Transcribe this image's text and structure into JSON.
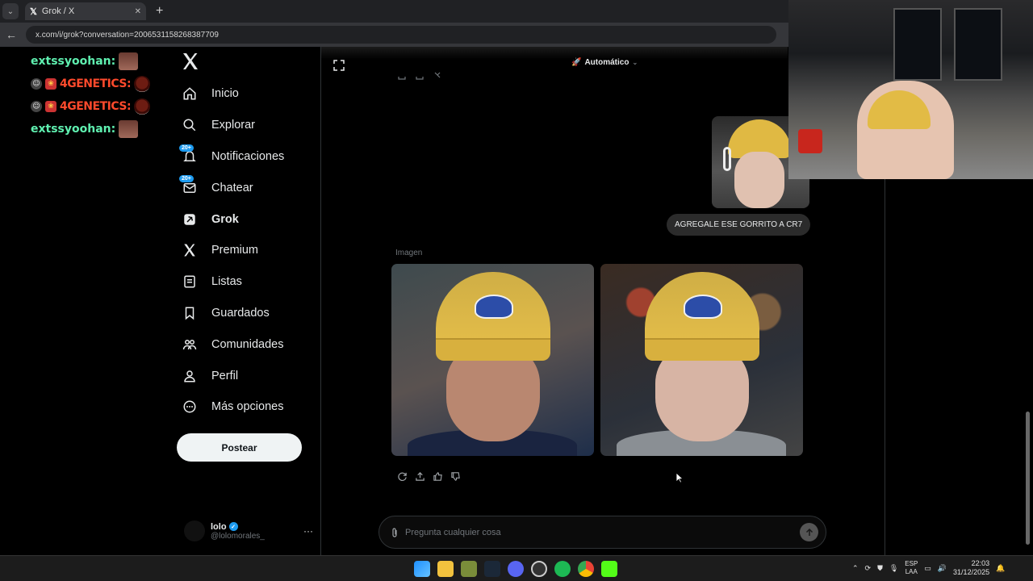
{
  "browser": {
    "tab_title": "Grok / X",
    "url": "x.com/i/grok?conversation=2006531158268387709",
    "new_tab": "+"
  },
  "stream_chat": {
    "lines": [
      {
        "user": "extssyoohan:"
      },
      {
        "user": "4GENETICS:"
      },
      {
        "user": "4GENETICS:"
      },
      {
        "user": "extssyoohan:"
      }
    ]
  },
  "sidebar": {
    "items": [
      {
        "label": "Inicio",
        "icon": "home-icon"
      },
      {
        "label": "Explorar",
        "icon": "search-icon"
      },
      {
        "label": "Notificaciones",
        "icon": "bell-icon",
        "badge": "20+"
      },
      {
        "label": "Chatear",
        "icon": "mail-icon",
        "badge": "20+"
      },
      {
        "label": "Grok",
        "icon": "grok-icon",
        "active": true
      },
      {
        "label": "Premium",
        "icon": "x-premium-icon"
      },
      {
        "label": "Listas",
        "icon": "list-icon"
      },
      {
        "label": "Guardados",
        "icon": "bookmark-icon"
      },
      {
        "label": "Comunidades",
        "icon": "communities-icon"
      },
      {
        "label": "Perfil",
        "icon": "person-icon"
      },
      {
        "label": "Más opciones",
        "icon": "more-circle-icon"
      }
    ],
    "post_button": "Postear",
    "profile": {
      "name": "lolo",
      "handle": "@lolomorales_",
      "more": "···"
    }
  },
  "grok": {
    "mode": "Automático",
    "user_message": "AGREGALE ESE GORRITO A CR7",
    "image_label": "Imagen",
    "composer_placeholder": "Pregunta cualquier cosa"
  },
  "taskbar": {
    "lang_top": "ESP",
    "lang_bottom": "LAA",
    "time": "22:03",
    "date": "31/12/2025",
    "colors": {
      "windows": "#1e90ff",
      "spotify": "#1db954",
      "chrome": "#f4b400",
      "discord": "#5865f2"
    }
  }
}
